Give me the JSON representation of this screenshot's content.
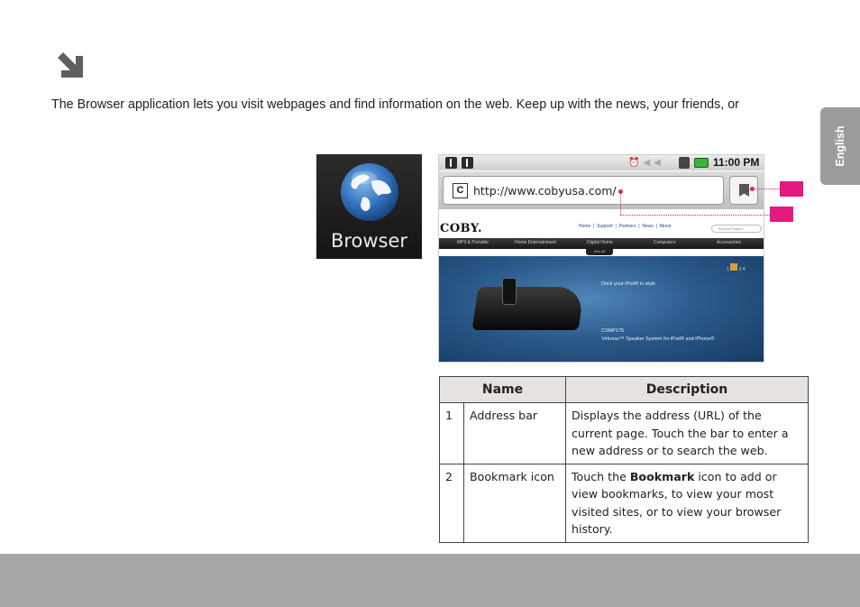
{
  "intro_text": "The Browser application lets you visit webpages and find information on the web. Keep up with the news, your friends, or",
  "sidebar_tab": "English",
  "app_icon": {
    "label": "Browser",
    "icon": "globe-icon"
  },
  "screenshot": {
    "status_bar": {
      "time": "11:00 PM",
      "icons": [
        "usb-icon",
        "usb-icon",
        "alarm-icon",
        "volume-icon",
        "wifi-icon",
        "battery-icon"
      ]
    },
    "address_bar": {
      "favicon": "C",
      "url": "http://www.cobyusa.com/"
    },
    "site": {
      "logo": "COBY.",
      "links": [
        "Home",
        "Support",
        "Partners",
        "News",
        "About"
      ],
      "search_placeholder": "Product Search",
      "nav_items": [
        "MP3 & Portable",
        "Home Entertainment",
        "Digital Home",
        "Computers",
        "Accessories"
      ],
      "see_all": "See All",
      "banner_pages": [
        "1",
        "2",
        "3",
        "4"
      ],
      "banner_tagline": "Dock your iPod® in style",
      "banner_model": "CSMP175",
      "banner_desc": "Virtuoso™ Speaker System for iPod® and iPhone®"
    }
  },
  "callout_color": "#e5197e",
  "table": {
    "headers": {
      "name": "Name",
      "description": "Description"
    },
    "rows": [
      {
        "num": "1",
        "name": "Address bar",
        "desc": "Displays the address (URL) of the current page. Touch the bar to enter a new address or to search the web."
      },
      {
        "num": "2",
        "name": "Bookmark icon",
        "desc_prefix": "Touch the ",
        "desc_bold": "Bookmark",
        "desc_suffix": " icon to add or view bookmarks, to view your most visited sites, or to view your browser history."
      }
    ]
  }
}
